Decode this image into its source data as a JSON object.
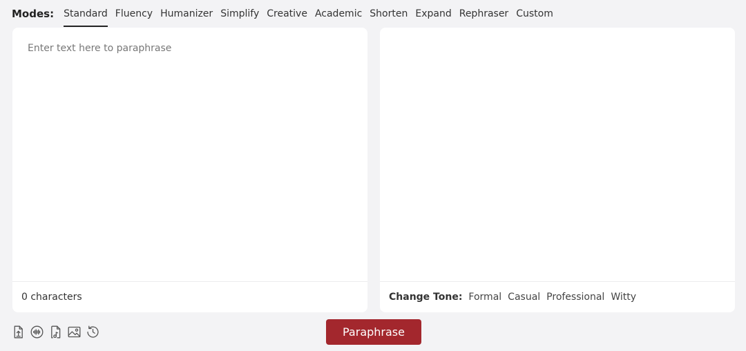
{
  "modes": {
    "label": "Modes:",
    "tabs": [
      {
        "label": "Standard",
        "active": true
      },
      {
        "label": "Fluency"
      },
      {
        "label": "Humanizer"
      },
      {
        "label": "Simplify"
      },
      {
        "label": "Creative"
      },
      {
        "label": "Academic"
      },
      {
        "label": "Shorten"
      },
      {
        "label": "Expand"
      },
      {
        "label": "Rephraser"
      },
      {
        "label": "Custom"
      }
    ]
  },
  "input": {
    "placeholder": "Enter text here to paraphrase",
    "value": "",
    "char_count": "0 characters"
  },
  "tone": {
    "label": "Change Tone:",
    "options": [
      "Formal",
      "Casual",
      "Professional",
      "Witty"
    ]
  },
  "tools": {
    "icons": [
      "upload-file-icon",
      "audio-icon",
      "music-file-icon",
      "image-icon",
      "history-icon"
    ]
  },
  "action": {
    "paraphrase_label": "Paraphrase",
    "accent_color": "#a3272d"
  }
}
